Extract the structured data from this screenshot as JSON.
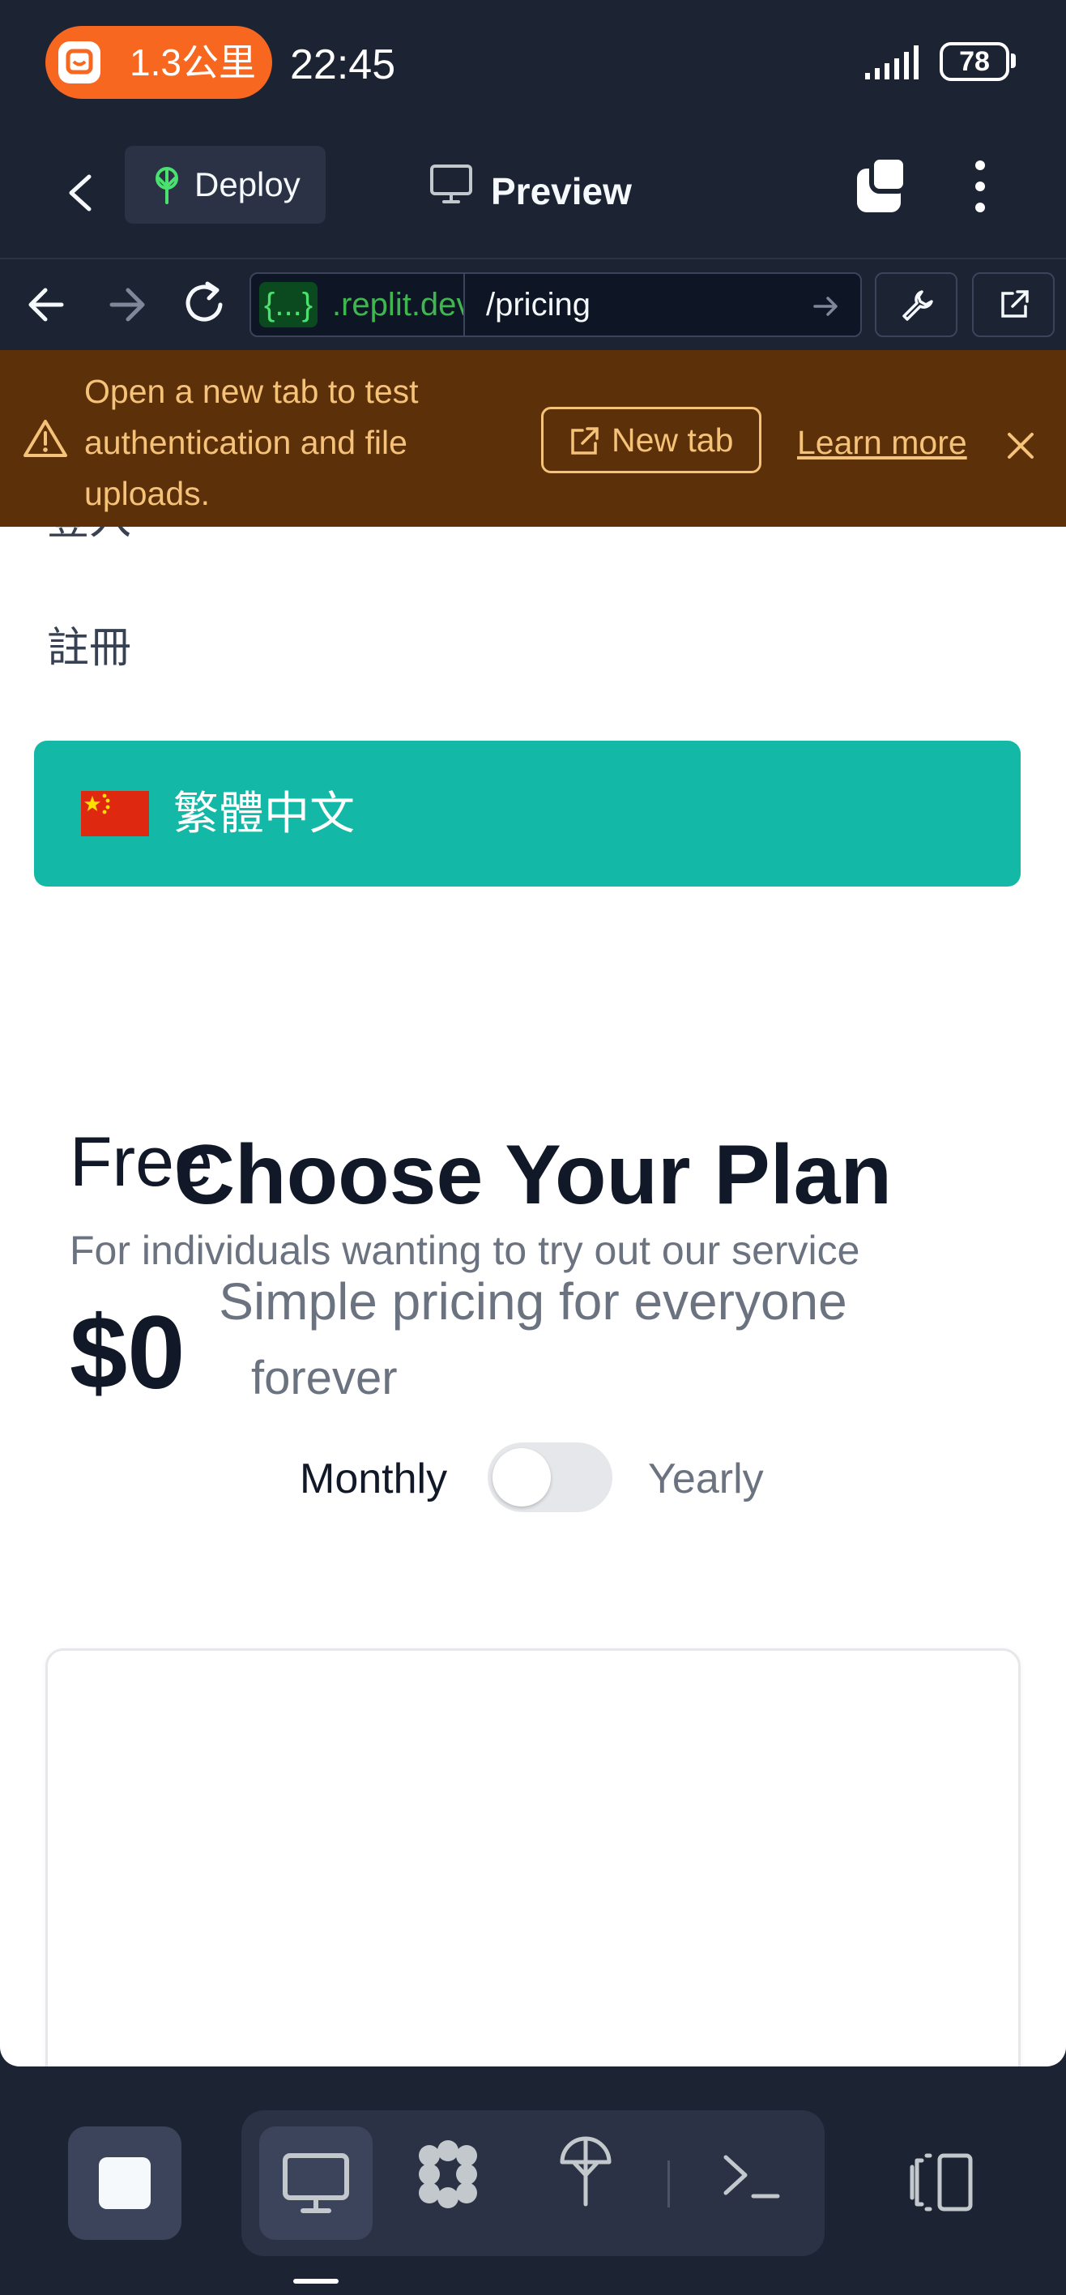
{
  "status_bar": {
    "ride_distance": "1.3公里",
    "time": "22:45",
    "battery": "78"
  },
  "toolbar": {
    "deploy_label": "Deploy",
    "preview_label": "Preview"
  },
  "url_bar": {
    "host_badge": "{...}",
    "host_rest": ".replit.dev",
    "path": "/pricing"
  },
  "banner": {
    "message": "Open a new tab to test authentication and file uploads.",
    "new_tab_label": "New tab",
    "learn_more_label": "Learn more"
  },
  "page": {
    "nav": {
      "login_label": "登入",
      "register_label": "註冊"
    },
    "language_button": {
      "flag": "cn-flag",
      "label": "繁體中文"
    },
    "title": "Choose Your Plan",
    "subtitle": "Simple pricing for everyone",
    "billing": {
      "monthly_label": "Monthly",
      "yearly_label": "Yearly",
      "yearly_selected": false
    },
    "plans": [
      {
        "name": "Free",
        "description": "For individuals wanting to try out our service",
        "price": "$0",
        "period": "forever"
      }
    ]
  },
  "bottom_bar": {
    "icons": [
      "stop-icon",
      "monitor-icon",
      "agent-icon",
      "deploy-icon",
      "shell-icon",
      "layout-icon"
    ]
  },
  "colors": {
    "ide_background": "#1c2333",
    "language_button": "#14b8a6",
    "banner_background": "#5c3008",
    "banner_text": "#f5c27a",
    "ride_pill": "#f7671f"
  }
}
